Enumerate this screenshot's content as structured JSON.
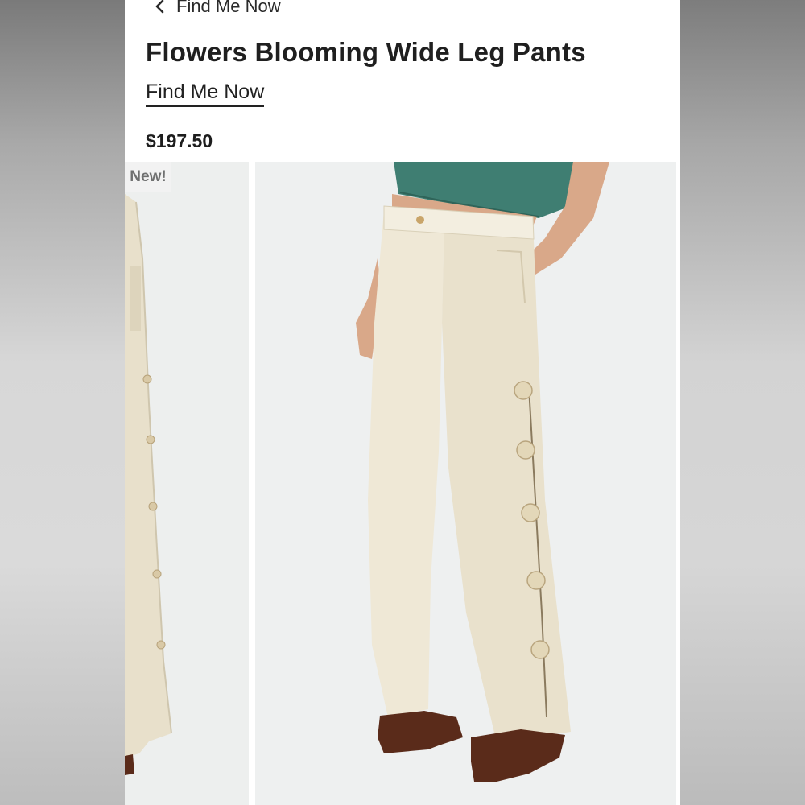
{
  "header": {
    "back_label": "Find Me Now"
  },
  "product": {
    "title": "Flowers Blooming Wide Leg Pants",
    "brand": "Find Me Now",
    "price": "$197.50",
    "badge": "New!"
  },
  "colors": {
    "pants": "#efe8d6",
    "top": "#3f7e72",
    "shoes": "#5a2b1a",
    "skin": "#d9a889"
  }
}
